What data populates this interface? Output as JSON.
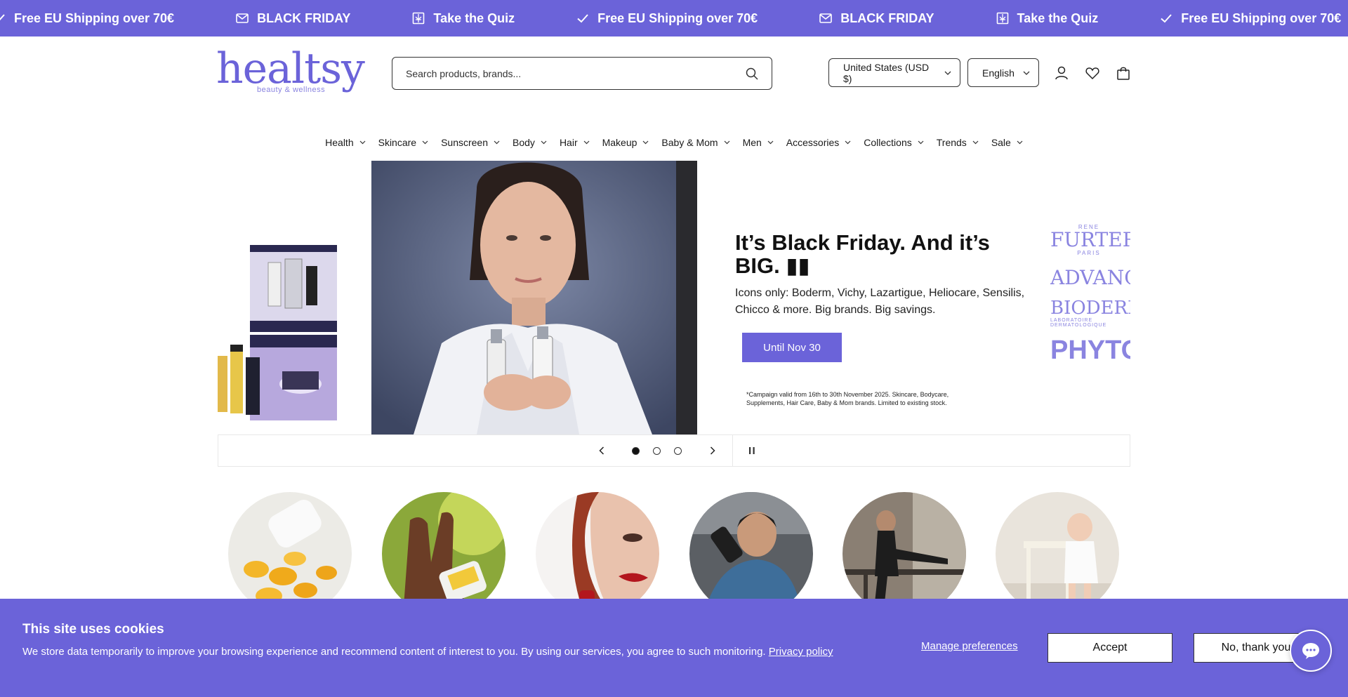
{
  "colors": {
    "brand": "#6b63d9",
    "brand_light": "#8a84e0"
  },
  "announcement": {
    "items": [
      {
        "icon": "check-icon",
        "text": "Free EU Shipping over 70€"
      },
      {
        "icon": "mail-icon",
        "text": "BLACK FRIDAY"
      },
      {
        "icon": "quiz-icon",
        "text": "Take the Quiz"
      },
      {
        "icon": "check-icon",
        "text": "Free EU Shipping over 70€"
      },
      {
        "icon": "mail-icon",
        "text": "BLACK FRIDAY"
      },
      {
        "icon": "quiz-icon",
        "text": "Take the Quiz"
      },
      {
        "icon": "check-icon",
        "text": "Free EU Shipping over 70€"
      }
    ]
  },
  "header": {
    "logo_text": "healtsy",
    "logo_tagline": "beauty & wellness",
    "search_placeholder": "Search products, brands...",
    "country": "United States (USD $)",
    "language": "English"
  },
  "nav": {
    "items": [
      "Health",
      "Skincare",
      "Sunscreen",
      "Body",
      "Hair",
      "Makeup",
      "Baby & Mom",
      "Men",
      "Accessories",
      "Collections",
      "Trends",
      "Sale"
    ]
  },
  "hero": {
    "title": "It’s Black Friday. And it’s BIG. ▮▮",
    "subtitle": "Icons only: Boderm, Vichy, Lazartigue, Heliocare, Sensilis, Chicco & more. Big brands. Big savings.",
    "cta": "Until Nov 30",
    "fine_print": "*Campaign valid from 16th to 30th November 2025. Skincare, Bodycare, Supplements, Hair Care, Baby & Mom brands. Limited to existing stock.",
    "brands": [
      "FURTERER",
      "ADVANCED",
      "BIODERMA",
      "PHYTO"
    ],
    "brand_subs": [
      "RENE",
      "PARIS",
      "LABORATOIRE DERMATOLOGIQUE"
    ],
    "slides": 3,
    "active_slide": 1
  },
  "cookie": {
    "title": "This site uses cookies",
    "text": "We store data temporarily to improve your browsing experience and recommend content of interest to you. By using our services, you agree to such monitoring.",
    "privacy_link": "Privacy policy",
    "manage": "Manage preferences",
    "accept": "Accept",
    "decline": "No, thank you"
  }
}
